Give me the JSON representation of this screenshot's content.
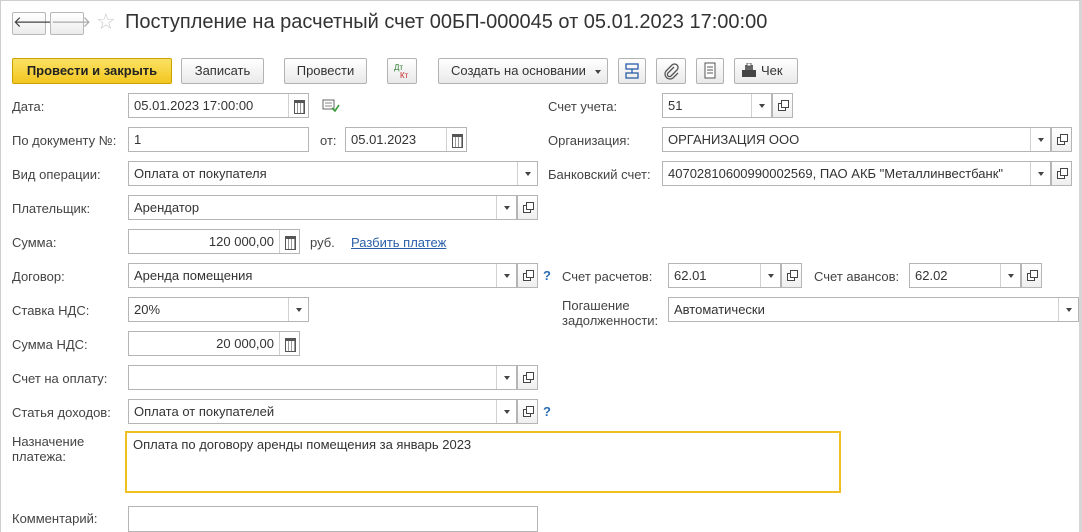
{
  "window": {
    "title": "Поступление на расчетный счет 00БП-000045 от 05.01.2023 17:00:00"
  },
  "nav": {
    "back_glyph": "🡐",
    "forward_glyph": "🡒"
  },
  "toolbar": {
    "post_close": "Провести и закрыть",
    "save": "Записать",
    "post": "Провести",
    "dt_kt": "Дт Кт",
    "create_based": "Создать на основании",
    "check": "Чек"
  },
  "form": {
    "date_label": "Дата:",
    "date_value": "05.01.2023 17:00:00",
    "doc_num_label": "По документу №:",
    "doc_num_value": "1",
    "from_label": "от:",
    "from_value": "05.01.2023",
    "op_type_label": "Вид операции:",
    "op_type_value": "Оплата от покупателя",
    "payer_label": "Плательщик:",
    "payer_value": "Арендатор",
    "sum_label": "Сумма:",
    "sum_value": "120 000,00",
    "currency": "руб.",
    "split_link": "Разбить платеж",
    "contract_label": "Договор:",
    "contract_value": "Аренда помещения",
    "vat_rate_label": "Ставка НДС:",
    "vat_rate_value": "20%",
    "vat_sum_label": "Сумма НДС:",
    "vat_sum_value": "20 000,00",
    "invoice_label": "Счет на оплату:",
    "invoice_value": "",
    "income_item_label": "Статья доходов:",
    "income_item_value": "Оплата от покупателей",
    "purpose_label_1": "Назначение",
    "purpose_label_2": "платежа:",
    "purpose_value": "Оплата по договору аренды помещения за январь 2023",
    "comment_label": "Комментарий:",
    "comment_value": "",
    "account_label": "Счет учета:",
    "account_value": "51",
    "org_label": "Организация:",
    "org_value": "ОРГАНИЗАЦИЯ ООО",
    "bank_label": "Банковский счет:",
    "bank_value": "40702810600990002569, ПАО АКБ \"Металлинвестбанк\"",
    "settle_label": "Счет расчетов:",
    "settle_value": "62.01",
    "advance_label": "Счет авансов:",
    "advance_value": "62.02",
    "debt_label_1": "Погашение",
    "debt_label_2": "задолженности:",
    "debt_value": "Автоматически",
    "help_glyph": "?"
  }
}
